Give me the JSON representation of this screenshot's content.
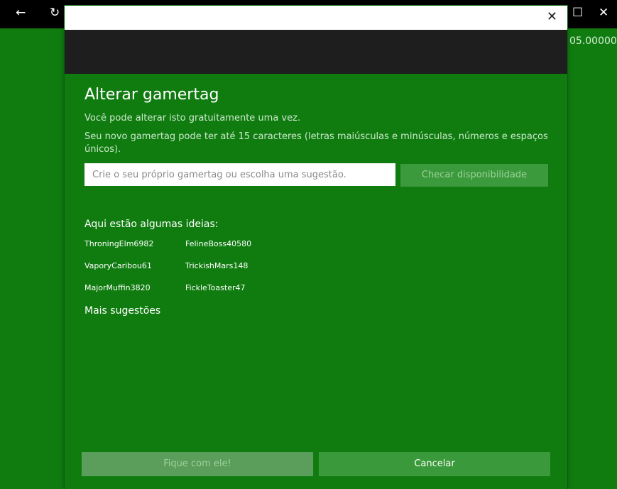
{
  "background_app": {
    "titlebar": {
      "back_icon": "←",
      "refresh_icon": "↻",
      "maximize_icon": "☐",
      "close_icon": "✕"
    },
    "partial_value": "05.00000"
  },
  "dialog": {
    "close_icon": "✕",
    "title": "Alterar gamertag",
    "info1": "Você pode alterar isto gratuitamente uma vez.",
    "info2": "Seu novo gamertag pode ter até 15 caracteres (letras maiúsculas e minúsculas, números e espaços únicos).",
    "input": {
      "value": "",
      "placeholder": "Crie o seu próprio gamertag ou escolha uma sugestão."
    },
    "check_button": "Checar disponibilidade",
    "ideas_heading": "Aqui estão algumas ideias:",
    "ideas": [
      [
        "ThroningElm6982",
        "FelineBoss40580"
      ],
      [
        "VaporyCaribou61",
        "TrickishMars148"
      ],
      [
        "MajorMuffin3820",
        "FickleToaster47"
      ]
    ],
    "more_suggestions": "Mais sugestões",
    "keep_button": "Fique com ele!",
    "cancel_button": "Cancelar"
  },
  "colors": {
    "accent_green": "#107c10",
    "header_dark": "#1e1e1e",
    "button_green": "#3a993a"
  }
}
